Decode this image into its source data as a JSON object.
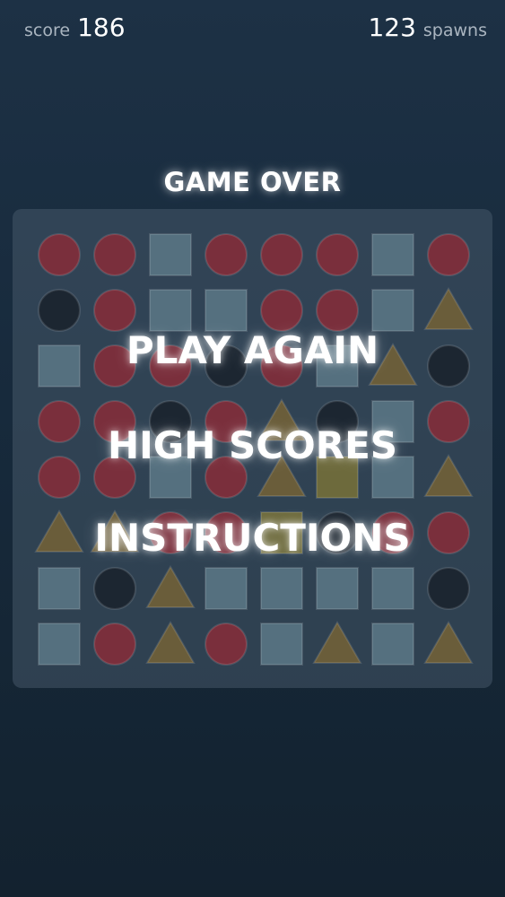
{
  "hud": {
    "score_label": "score",
    "score_value": "186",
    "spawns_value": "123",
    "spawns_label": "spawns"
  },
  "title": "GAME OVER",
  "menu": {
    "play_again": "PLAY AGAIN",
    "high_scores": "HIGH SCORES",
    "instructions": "INSTRUCTIONS"
  },
  "board": {
    "rows": [
      [
        "circle-red",
        "circle-red",
        "square",
        "circle-red",
        "circle-red",
        "circle-red",
        "square",
        "circle-red"
      ],
      [
        "circle-dark",
        "circle-red",
        "square",
        "square",
        "circle-red",
        "circle-red",
        "square",
        "triangle"
      ],
      [
        "square",
        "circle-red",
        "circle-red",
        "circle-dark",
        "circle-red",
        "square",
        "triangle",
        "circle-dark"
      ],
      [
        "circle-red",
        "circle-red",
        "circle-dark",
        "circle-red",
        "triangle",
        "circle-dark",
        "square",
        "circle-red"
      ],
      [
        "circle-red",
        "circle-red",
        "square",
        "circle-red",
        "triangle",
        "square-yellow",
        "square",
        "triangle"
      ],
      [
        "triangle",
        "triangle",
        "circle-red",
        "circle-red",
        "square-yellow",
        "circle-dark",
        "circle-red",
        "circle-red"
      ],
      [
        "square",
        "circle-dark",
        "triangle",
        "square",
        "square",
        "square",
        "square",
        "circle-dark"
      ],
      [
        "square",
        "circle-red",
        "triangle",
        "circle-red",
        "square",
        "triangle",
        "square",
        "triangle"
      ]
    ],
    "colors": {
      "circle-red": "#7a2f3c",
      "circle-dark": "#1c2631",
      "square": "#55707f",
      "square-yellow": "#6d6a3c",
      "triangle": "#6a5d3a"
    }
  }
}
